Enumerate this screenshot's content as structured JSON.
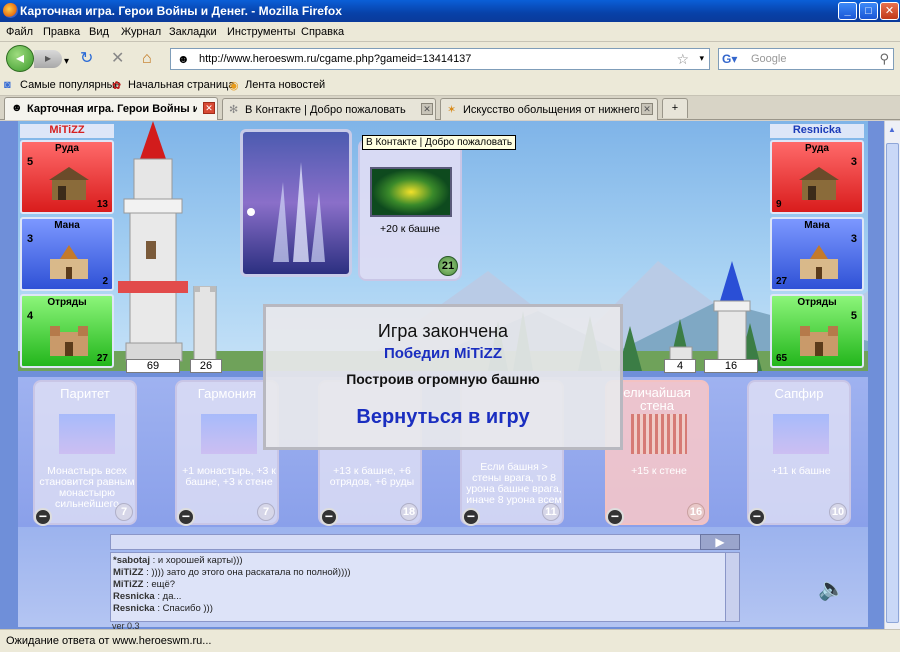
{
  "window": {
    "title": "Карточная игра. Герои Войны и Денег. - Mozilla Firefox",
    "min": "_",
    "max": "□",
    "close": "✕"
  },
  "menu": [
    "Файл",
    "Правка",
    "Вид",
    "Журнал",
    "Закладки",
    "Инструменты",
    "Справка"
  ],
  "nav": {
    "url": "http://www.heroeswm.ru/cgame.php?gameid=13414137",
    "search_placeholder": "Google"
  },
  "bookmarks": [
    "Самые популярные",
    "Начальная страница",
    "Лента новостей"
  ],
  "tabs": [
    {
      "label": "Карточная игра. Герои Войны и ..."
    },
    {
      "label": "В Контакте | Добро пожаловать"
    },
    {
      "label": "Искусство обольщения от нижнего б..."
    }
  ],
  "tooltip": "В Контакте | Добро пожаловать",
  "player_left": {
    "name": "MiTiZZ",
    "res": [
      {
        "label": "Руда",
        "prod": "5",
        "qty": "13"
      },
      {
        "label": "Мана",
        "prod": "3",
        "qty": "2"
      },
      {
        "label": "Отряды",
        "prod": "4",
        "qty": "27"
      }
    ],
    "tower": "69",
    "wall": "26"
  },
  "player_right": {
    "name": "Resnicka",
    "res": [
      {
        "label": "Руда",
        "prod": "3",
        "qty": "9"
      },
      {
        "label": "Мана",
        "prod": "3",
        "qty": "27"
      },
      {
        "label": "Отряды",
        "prod": "5",
        "qty": "65"
      }
    ],
    "tower": "16",
    "wall": "4"
  },
  "played_card": {
    "desc": "+20 к башне",
    "cost": "21"
  },
  "dialog": {
    "title": "Игра закончена",
    "winner": "Победил MiTiZZ",
    "reason": "Построив огромную башню",
    "button": "Вернуться в игру"
  },
  "hand": [
    {
      "title": "Паритет",
      "desc": "Монастырь всех становится равным монастырю сильнейшего",
      "cost": "7"
    },
    {
      "title": "Гармония",
      "desc": "+1 монастырь, +3 к башне, +3 к стене",
      "cost": "7"
    },
    {
      "title": "",
      "desc": "+13 к башне, +6 отрядов, +6 руды",
      "cost": "18"
    },
    {
      "title": "",
      "desc": "Если башня > стены врага, то 8 урона башне врага, иначе 8 урона всем",
      "cost": "11"
    },
    {
      "title": "еличайшая стена",
      "desc": "+15 к стене",
      "cost": "16"
    },
    {
      "title": "Сапфир",
      "desc": "+11 к башне",
      "cost": "10"
    }
  ],
  "chat": {
    "send": "▶",
    "lines": [
      {
        "who": "*sabotaj",
        "text": " : и хорошей карты)))"
      },
      {
        "who": "MiTiZZ",
        "text": " : )))) зато до этого она раскатала по полной))))"
      },
      {
        "who": "MiTiZZ",
        "text": " : ещё?"
      },
      {
        "who": "Resnicka",
        "text": " : да..."
      },
      {
        "who": "Resnicka",
        "text": " : Спасибо )))"
      }
    ],
    "version": "ver 0.3"
  },
  "status": "Ожидание ответа от www.heroeswm.ru..."
}
